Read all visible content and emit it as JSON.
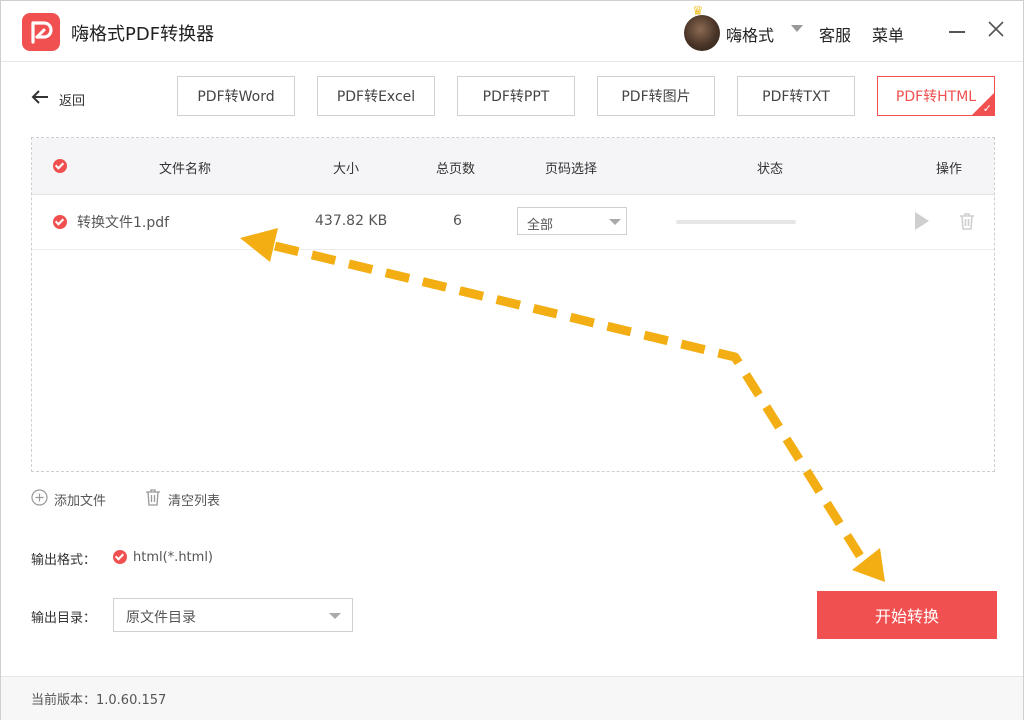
{
  "app": {
    "title": "嗨格式PDF转换器"
  },
  "header": {
    "username": "嗨格式",
    "kefu": "客服",
    "menu": "菜单"
  },
  "toolbar": {
    "back_label": "返回",
    "tabs": [
      {
        "label": "PDF转Word",
        "active": false
      },
      {
        "label": "PDF转Excel",
        "active": false
      },
      {
        "label": "PDF转PPT",
        "active": false
      },
      {
        "label": "PDF转图片",
        "active": false
      },
      {
        "label": "PDF转TXT",
        "active": false
      },
      {
        "label": "PDF转HTML",
        "active": true
      }
    ]
  },
  "table": {
    "headers": {
      "name": "文件名称",
      "size": "大小",
      "pages": "总页数",
      "page_select": "页码选择",
      "status": "状态",
      "actions": "操作"
    },
    "rows": [
      {
        "name": "转换文件1.pdf",
        "size": "437.82 KB",
        "pages": "6",
        "page_select": "全部",
        "progress": 0
      }
    ]
  },
  "actions": {
    "add_file": "添加文件",
    "clear_list": "清空列表"
  },
  "output": {
    "format_label": "输出格式：",
    "format_value": "html(*.html)",
    "dir_label": "输出目录：",
    "dir_value": "原文件目录"
  },
  "start_button": "开始转换",
  "footer": {
    "version": "当前版本：1.0.60.157"
  },
  "colors": {
    "accent": "#f05050",
    "annotation_arrow": "#f3ae14"
  },
  "icons": {
    "back": "arrow-left-icon",
    "play": "play-icon",
    "trash": "trash-icon",
    "add": "plus-circle-icon",
    "clear": "trash-icon",
    "close": "close-icon",
    "minimize": "minimize-icon"
  }
}
